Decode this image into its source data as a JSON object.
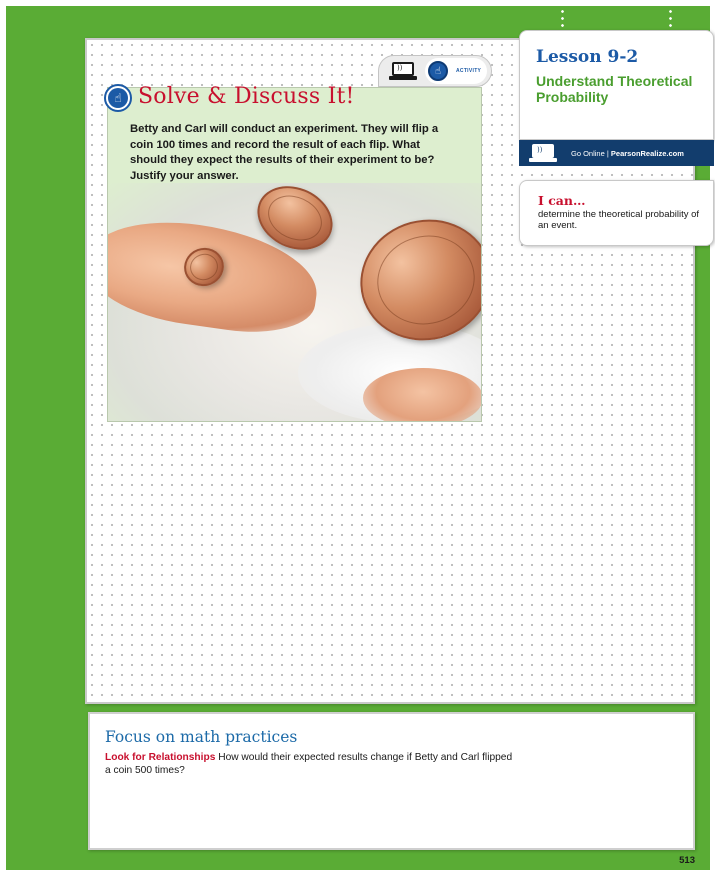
{
  "activity_tab": {
    "label": "ACTIVITY"
  },
  "solve": {
    "title": "Solve & Discuss It!",
    "text": "Betty and Carl will conduct an experiment. They will flip a coin 100 times and record the result of each flip. What should they expect the results of their experiment to be? Justify your answer."
  },
  "lesson": {
    "number": "Lesson 9-2",
    "name": "Understand Theoretical Probability",
    "go_online": "Go Online",
    "separator": "|",
    "site": "PearsonRealize.com"
  },
  "ican": {
    "title": "I can…",
    "text": "determine the theoretical probability of an event."
  },
  "focus": {
    "title": "Focus on math practices",
    "lead": "Look for Relationships",
    "text": "How would their expected results change if Betty and Carl flipped a coin 500 times?"
  },
  "page_number": "513",
  "icons": {
    "laptop": "laptop-wifi-icon",
    "activity": "hand-pointer-icon"
  },
  "colors": {
    "frame_green": "#5aac35",
    "title_red": "#c8102e",
    "lesson_blue": "#1c5aa6",
    "lesson_green": "#4a9e2f",
    "go_online_navy": "#123d6d",
    "focus_blue": "#1c6aa8"
  }
}
